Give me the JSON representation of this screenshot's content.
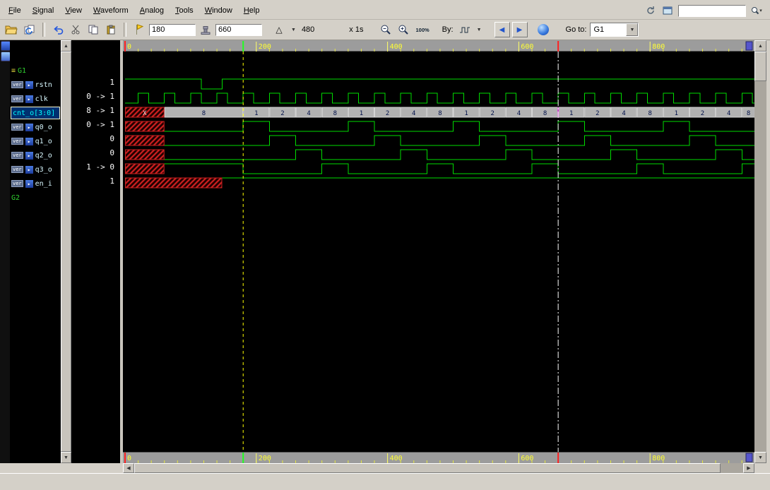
{
  "menubar": {
    "items": [
      "File",
      "Signal",
      "View",
      "Waveform",
      "Analog",
      "Tools",
      "Window",
      "Help"
    ],
    "search_value": ""
  },
  "toolbar": {
    "cursor_time": "180",
    "marker_time": "660",
    "range": "480",
    "scale_label": "x 1s",
    "zoom_pct": "100%",
    "by_label": "By:",
    "goto_label": "Go to:",
    "goto_value": "G1"
  },
  "signal_panel": {
    "groups": [
      {
        "label": "G1"
      },
      {
        "label": "G2"
      }
    ],
    "rows": [
      {
        "badge": "ver",
        "name": "rstn",
        "value": "1",
        "selected": false
      },
      {
        "badge": "ver",
        "name": "clk",
        "value": "0 -> 1",
        "selected": false
      },
      {
        "badge": "",
        "name": "cnt_o[3:0]",
        "value": "8 -> 1",
        "selected": true
      },
      {
        "badge": "ver",
        "name": "q0_o",
        "value": "0 -> 1",
        "selected": false
      },
      {
        "badge": "ver",
        "name": "q1_o",
        "value": "0",
        "selected": false
      },
      {
        "badge": "ver",
        "name": "q2_o",
        "value": "0",
        "selected": false
      },
      {
        "badge": "ver",
        "name": "q3_o",
        "value": "1 -> 0",
        "selected": false
      },
      {
        "badge": "ver",
        "name": "en_i",
        "value": "1",
        "selected": false
      }
    ]
  },
  "chart_data": {
    "type": "waveform",
    "time_unit": "1s",
    "time_range": [
      0,
      960
    ],
    "ruler": {
      "major_ticks": [
        0,
        200,
        400,
        600,
        800
      ],
      "minor_step": 20,
      "markers": [
        {
          "t": 0,
          "color": "#ff2020"
        },
        {
          "t": 180,
          "color": "#20ff20"
        },
        {
          "t": 660,
          "color": "#ff2020"
        }
      ]
    },
    "cursors": [
      {
        "t": 180,
        "color": "#ffff00",
        "dash": "4,4"
      },
      {
        "t": 660,
        "color": "#ffffff",
        "dash": "9,3,2,3"
      }
    ],
    "signals": [
      {
        "name": "rstn",
        "kind": "bit",
        "edges": [
          [
            0,
            1
          ],
          [
            116,
            0
          ],
          [
            148,
            1
          ]
        ]
      },
      {
        "name": "clk",
        "kind": "clock",
        "first_rise": 20,
        "period": 40,
        "high_width": 16
      },
      {
        "name": "cnt_o[3:0]",
        "kind": "bus",
        "segments": [
          [
            0,
            "X"
          ],
          [
            60,
            "8"
          ],
          [
            180,
            "1"
          ],
          [
            220,
            "2"
          ],
          [
            260,
            "4"
          ],
          [
            300,
            "8"
          ],
          [
            340,
            "1"
          ],
          [
            380,
            "2"
          ],
          [
            420,
            "4"
          ],
          [
            460,
            "8"
          ],
          [
            500,
            "1"
          ],
          [
            540,
            "2"
          ],
          [
            580,
            "4"
          ],
          [
            620,
            "8"
          ],
          [
            660,
            "1"
          ],
          [
            700,
            "2"
          ],
          [
            740,
            "4"
          ],
          [
            780,
            "8"
          ],
          [
            820,
            "1"
          ],
          [
            860,
            "2"
          ],
          [
            900,
            "4"
          ],
          [
            940,
            "8"
          ]
        ]
      },
      {
        "name": "q0_o",
        "kind": "bit",
        "unknown_until": 60,
        "edges": [
          [
            60,
            0
          ],
          [
            180,
            1
          ],
          [
            220,
            0
          ],
          [
            340,
            1
          ],
          [
            380,
            0
          ],
          [
            500,
            1
          ],
          [
            540,
            0
          ],
          [
            660,
            1
          ],
          [
            700,
            0
          ],
          [
            820,
            1
          ],
          [
            860,
            0
          ]
        ]
      },
      {
        "name": "q1_o",
        "kind": "bit",
        "unknown_until": 60,
        "edges": [
          [
            60,
            0
          ],
          [
            220,
            1
          ],
          [
            260,
            0
          ],
          [
            380,
            1
          ],
          [
            420,
            0
          ],
          [
            540,
            1
          ],
          [
            580,
            0
          ],
          [
            700,
            1
          ],
          [
            740,
            0
          ],
          [
            860,
            1
          ],
          [
            900,
            0
          ]
        ]
      },
      {
        "name": "q2_o",
        "kind": "bit",
        "unknown_until": 60,
        "edges": [
          [
            60,
            0
          ],
          [
            260,
            1
          ],
          [
            300,
            0
          ],
          [
            420,
            1
          ],
          [
            460,
            0
          ],
          [
            580,
            1
          ],
          [
            620,
            0
          ],
          [
            740,
            1
          ],
          [
            780,
            0
          ],
          [
            900,
            1
          ],
          [
            940,
            0
          ]
        ]
      },
      {
        "name": "q3_o",
        "kind": "bit",
        "unknown_until": 60,
        "edges": [
          [
            60,
            1
          ],
          [
            180,
            0
          ],
          [
            300,
            1
          ],
          [
            340,
            0
          ],
          [
            460,
            1
          ],
          [
            500,
            0
          ],
          [
            620,
            1
          ],
          [
            660,
            0
          ],
          [
            780,
            1
          ],
          [
            820,
            0
          ],
          [
            940,
            1
          ]
        ]
      },
      {
        "name": "en_i",
        "kind": "bit",
        "unknown_until": 148,
        "edges": [
          [
            148,
            1
          ]
        ]
      }
    ],
    "colors": {
      "wave": "#00dd00",
      "bus_fill": "#b2b2b2",
      "bus_text": "#00104a",
      "unknown": "#cc2020",
      "ruler_bg": "#9c9c9c",
      "tick": "#ffff33"
    }
  }
}
